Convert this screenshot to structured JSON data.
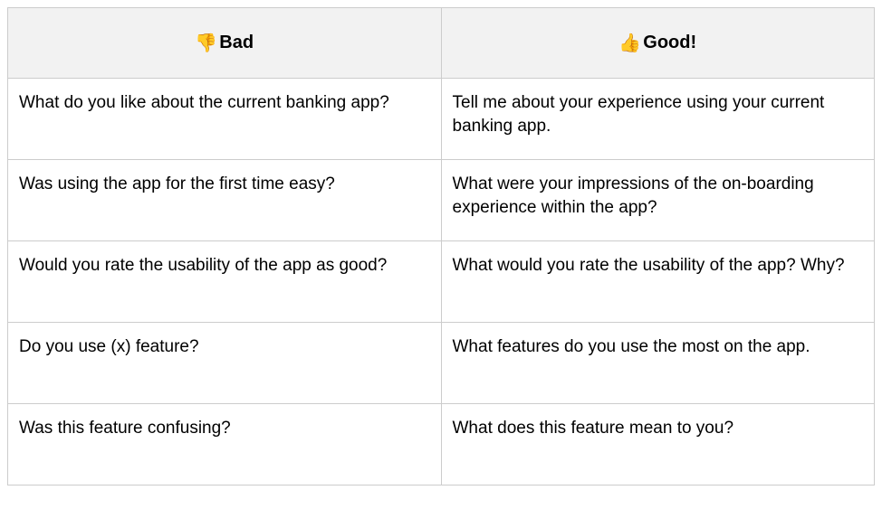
{
  "table": {
    "headers": {
      "bad": {
        "emoji": "👎",
        "label": "Bad"
      },
      "good": {
        "emoji": "👍",
        "label": "Good!"
      }
    },
    "rows": [
      {
        "bad": "What do you like about the current banking app?",
        "good": "Tell me about your experience using your current banking app."
      },
      {
        "bad": "Was using the app for the first time easy?",
        "good": "What were your impressions of the on-boarding experience within the app?"
      },
      {
        "bad": "Would you rate the usability of the app as good?",
        "good": "What would you rate the usability of the app? Why?"
      },
      {
        "bad": "Do you use (x) feature?",
        "good": "What features do you use the most on the app."
      },
      {
        "bad": "Was this feature confusing?",
        "good": "What does this feature mean to you?"
      }
    ]
  }
}
